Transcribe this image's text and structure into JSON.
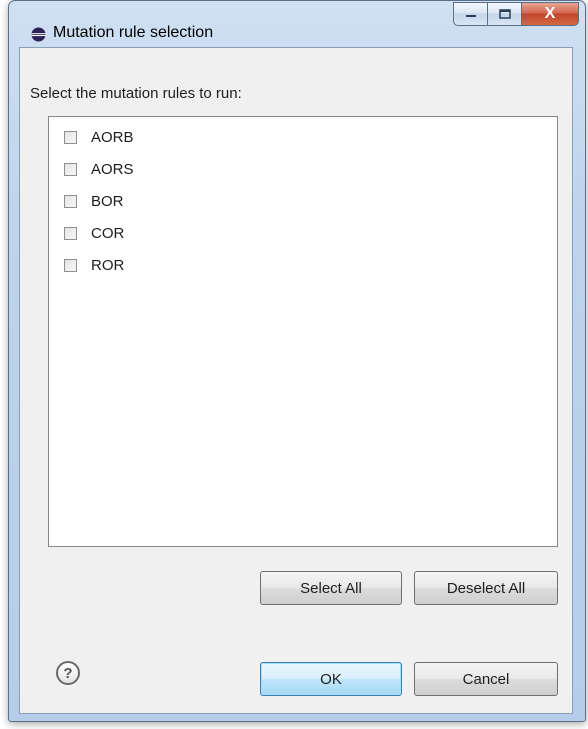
{
  "window": {
    "title": "Mutation rule selection",
    "icon": "eclipse-icon",
    "close_glyph": "X"
  },
  "prompt": "Select the mutation rules to run:",
  "rules": [
    {
      "label": "AORB",
      "checked": false
    },
    {
      "label": "AORS",
      "checked": false
    },
    {
      "label": "BOR",
      "checked": false
    },
    {
      "label": "COR",
      "checked": false
    },
    {
      "label": "ROR",
      "checked": false
    }
  ],
  "buttons": {
    "select_all": "Select All",
    "deselect_all": "Deselect All",
    "ok": "OK",
    "cancel": "Cancel"
  },
  "help_glyph": "?"
}
